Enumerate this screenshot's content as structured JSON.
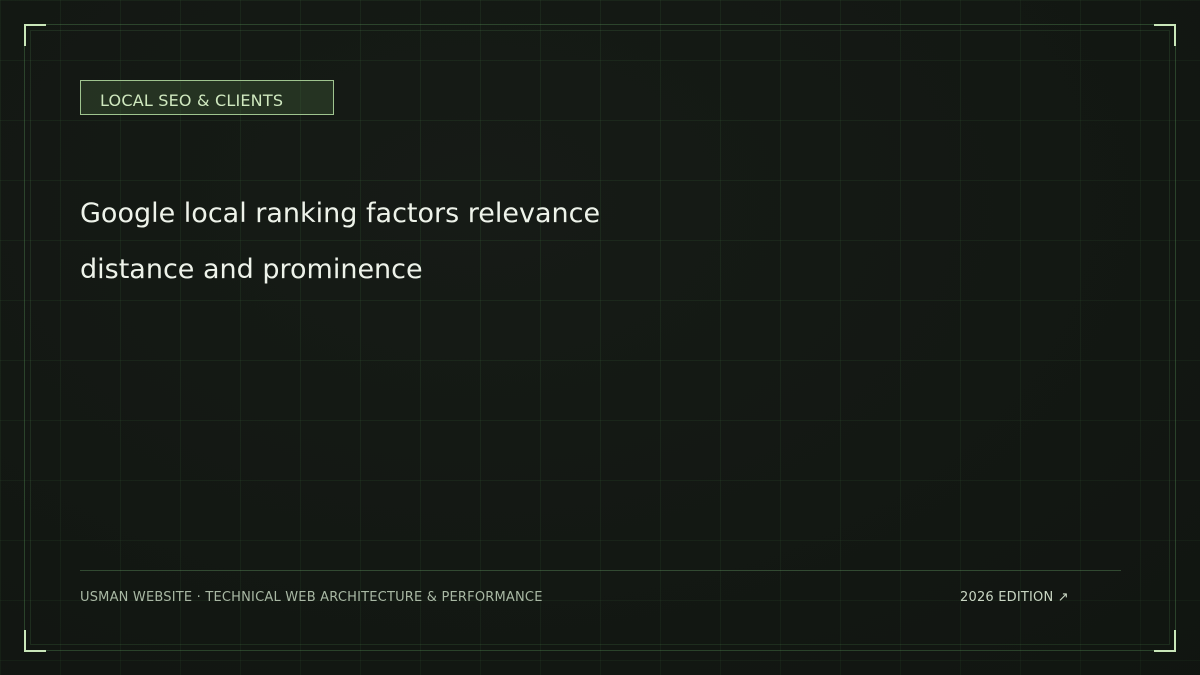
{
  "tag": "LOCAL SEO & CLIENTS",
  "headline": {
    "line1": "Google local ranking factors relevance",
    "line2": "distance and prominence"
  },
  "footer": {
    "left": "USMAN WEBSITE · TECHNICAL WEB ARCHITECTURE & PERFORMANCE",
    "right": "2026 EDITION ↗"
  },
  "colors": {
    "background": "#161b16",
    "accent": "#c9e6b9",
    "grid": "#3c5a3c"
  }
}
